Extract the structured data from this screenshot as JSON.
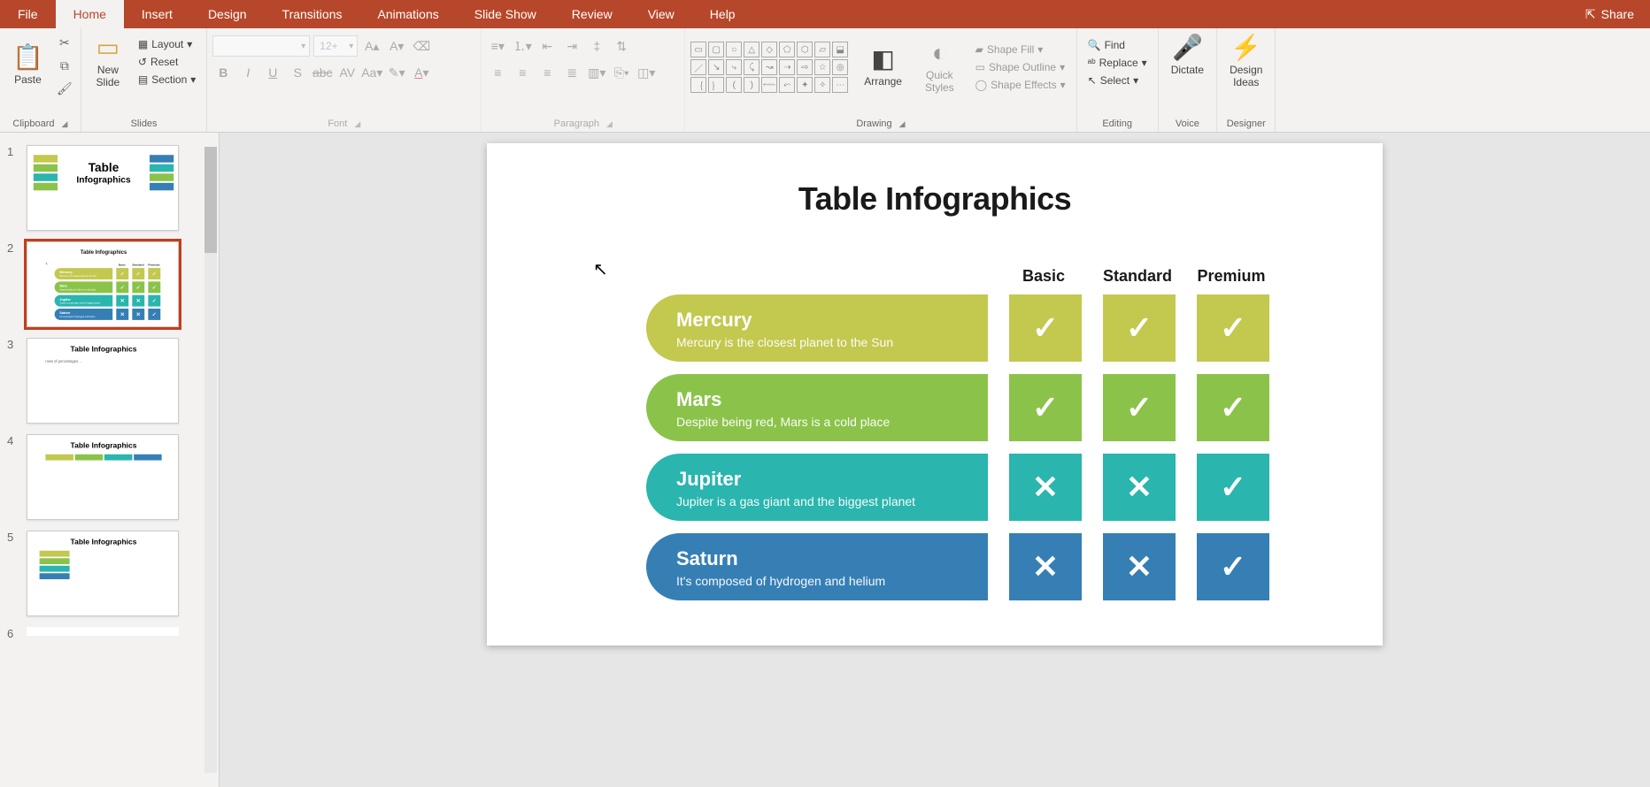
{
  "tabs": {
    "file": "File",
    "home": "Home",
    "insert": "Insert",
    "design": "Design",
    "transitions": "Transitions",
    "animations": "Animations",
    "slideshow": "Slide Show",
    "review": "Review",
    "view": "View",
    "help": "Help",
    "share": "Share"
  },
  "ribbon": {
    "clipboard": {
      "paste": "Paste",
      "label": "Clipboard"
    },
    "slides": {
      "new_slide": "New\nSlide",
      "layout": "Layout",
      "reset": "Reset",
      "section": "Section",
      "label": "Slides"
    },
    "font": {
      "font_name": "",
      "font_size": "12+",
      "label": "Font"
    },
    "paragraph": {
      "label": "Paragraph"
    },
    "drawing": {
      "arrange": "Arrange",
      "quick_styles": "Quick\nStyles",
      "shape_fill": "Shape Fill",
      "shape_outline": "Shape Outline",
      "shape_effects": "Shape Effects",
      "label": "Drawing"
    },
    "editing": {
      "find": "Find",
      "replace": "Replace",
      "select": "Select",
      "label": "Editing"
    },
    "voice": {
      "dictate": "Dictate",
      "label": "Voice"
    },
    "designer": {
      "design_ideas": "Design\nIdeas",
      "label": "Designer"
    }
  },
  "thumbs": [
    "1",
    "2",
    "3",
    "4",
    "5",
    "6"
  ],
  "slide": {
    "title": "Table Infographics",
    "headers": {
      "basic": "Basic",
      "standard": "Standard",
      "premium": "Premium"
    },
    "rows": [
      {
        "name": "Mercury",
        "desc": "Mercury is the closest planet to the Sun",
        "color": "c-olive",
        "cells": [
          "✓",
          "✓",
          "✓"
        ]
      },
      {
        "name": "Mars",
        "desc": "Despite being red, Mars is a cold place",
        "color": "c-green",
        "cells": [
          "✓",
          "✓",
          "✓"
        ]
      },
      {
        "name": "Jupiter",
        "desc": "Jupiter is a gas giant and the biggest planet",
        "color": "c-teal",
        "cells": [
          "✕",
          "✕",
          "✓"
        ]
      },
      {
        "name": "Saturn",
        "desc": "It's composed of hydrogen and helium",
        "color": "c-blue",
        "cells": [
          "✕",
          "✕",
          "✓"
        ]
      }
    ]
  }
}
